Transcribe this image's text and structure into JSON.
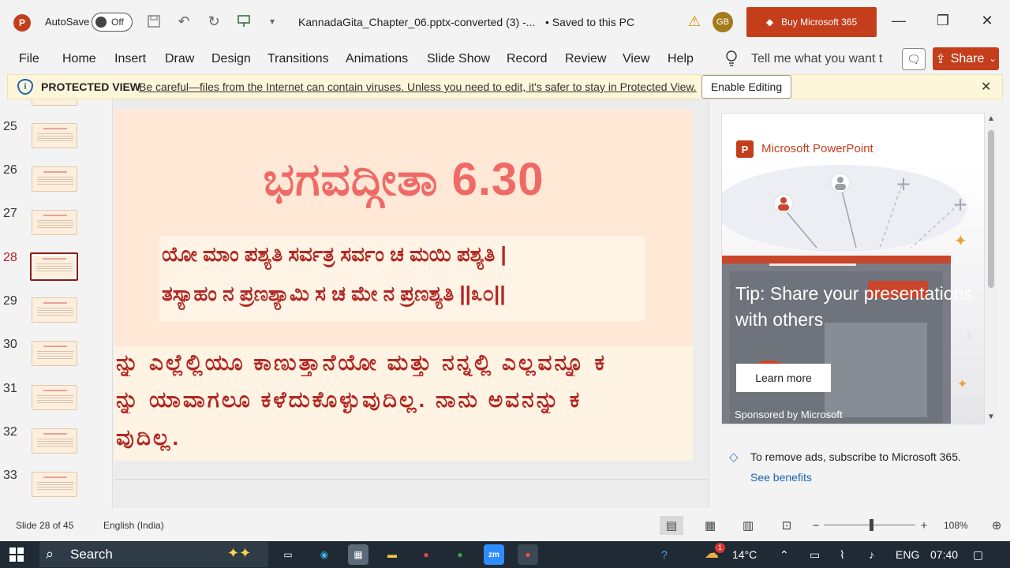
{
  "titlebar": {
    "app_icon": "P",
    "autosave_label": "AutoSave",
    "autosave_state": "Off",
    "doc_title": "KannadaGita_Chapter_06.pptx-converted (3)  -...",
    "save_status": "Saved to this PC",
    "user_initials": "GB",
    "buy_label": "Buy Microsoft 365"
  },
  "menu": {
    "items": [
      "File",
      "Home",
      "Insert",
      "Draw",
      "Design",
      "Transitions",
      "Animations",
      "Slide Show",
      "Record",
      "Review",
      "View",
      "Help"
    ],
    "tell_me_placeholder": "Tell me what you want t",
    "share_label": "Share"
  },
  "protected_view": {
    "title": "PROTECTED VIEW",
    "message": "Be careful—files from the Internet can contain viruses. Unless you need to edit, it's safer to stay in Protected View.",
    "enable_label": "Enable Editing"
  },
  "thumbnails": {
    "numbers": [
      "25",
      "26",
      "27",
      "28",
      "29",
      "30",
      "31",
      "32",
      "33"
    ],
    "active": "28"
  },
  "slide": {
    "title": "ಭಗವದ್ಗೀತಾ 6.30",
    "verse_line1": "ಯೋ ಮಾಂ ಪಶ್ಯತಿ ಸರ್ವತ್ರ ಸರ್ವಂ ಚ ಮಯಿ ಪಶ್ಯತಿ |",
    "verse_line2": "ತಸ್ಯಾಹಂ ನ ಪ್ರಣಶ್ಯಾಮಿ ಸ ಚ ಮೇ ನ ಪ್ರಣಶ್ಯತಿ ||೩೦||",
    "meaning_line1": "ನ್ನು ಎಲ್ಲೆಲ್ಲಿಯೂ ಕಾಣುತ್ತಾನೆಯೋ ಮತ್ತು ನನ್ನಲ್ಲಿ ಎಲ್ಲವನ್ನೂ ಕ",
    "meaning_line2": "ನ್ನು ಯಾವಾಗಲೂ ಕಳೆದುಕೊಳ್ಳುವುದಿಲ್ಲ. ನಾನು ಅವನನ್ನು ಕ",
    "meaning_line3": "ವುದಿಲ್ಲ."
  },
  "ad": {
    "brand": "Microsoft PowerPoint",
    "tip": "Tip: Share your presentations with others",
    "learn_more": "Learn more",
    "sponsored": "Sponsored by Microsoft",
    "remove_ads": "To remove ads, subscribe to Microsoft 365.",
    "see_benefits": "See benefits"
  },
  "status": {
    "slide_info": "Slide 28 of 45",
    "language": "English (India)",
    "zoom": "108%"
  },
  "taskbar": {
    "search_label": "Search",
    "weather_badge": "1",
    "temperature": "14°C",
    "language": "ENG",
    "time": "07:40"
  },
  "colors": {
    "brand_red": "#c43e1c",
    "slide_title": "#ef6a66",
    "slide_text": "#b22822",
    "slide_bg": "#ffe8d6"
  }
}
